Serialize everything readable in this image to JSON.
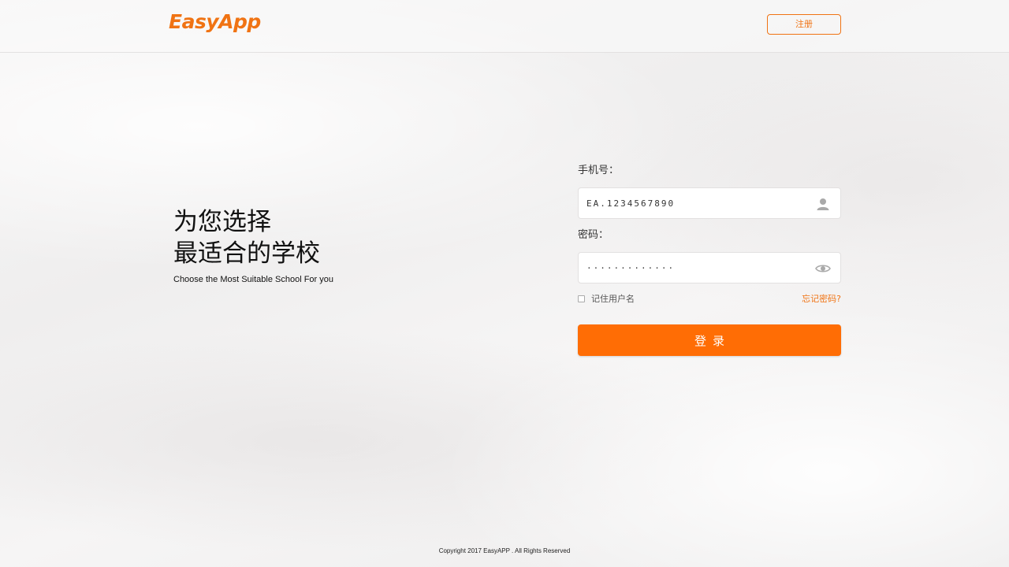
{
  "header": {
    "logo_text": "EasyApp",
    "register_label": "注册"
  },
  "slogan": {
    "line1": "为您选择",
    "line2": "最适合的学校",
    "subtitle": "Choose the Most Suitable School For you"
  },
  "form": {
    "phone_label": "手机号：",
    "phone_value": "EA.1234567890",
    "phone_icon": "user-icon",
    "password_label": "密码：",
    "password_value": "·············",
    "password_icon": "eye-icon",
    "remember_label": "记住用户名",
    "remember_checked": false,
    "forgot_label": "忘记密码?",
    "login_label": "登录"
  },
  "footer": {
    "copyright": "Copyright 2017  EasyAPP . All Rights Reserved"
  },
  "colors": {
    "accent": "#ff6d05",
    "brand": "#f07313"
  }
}
